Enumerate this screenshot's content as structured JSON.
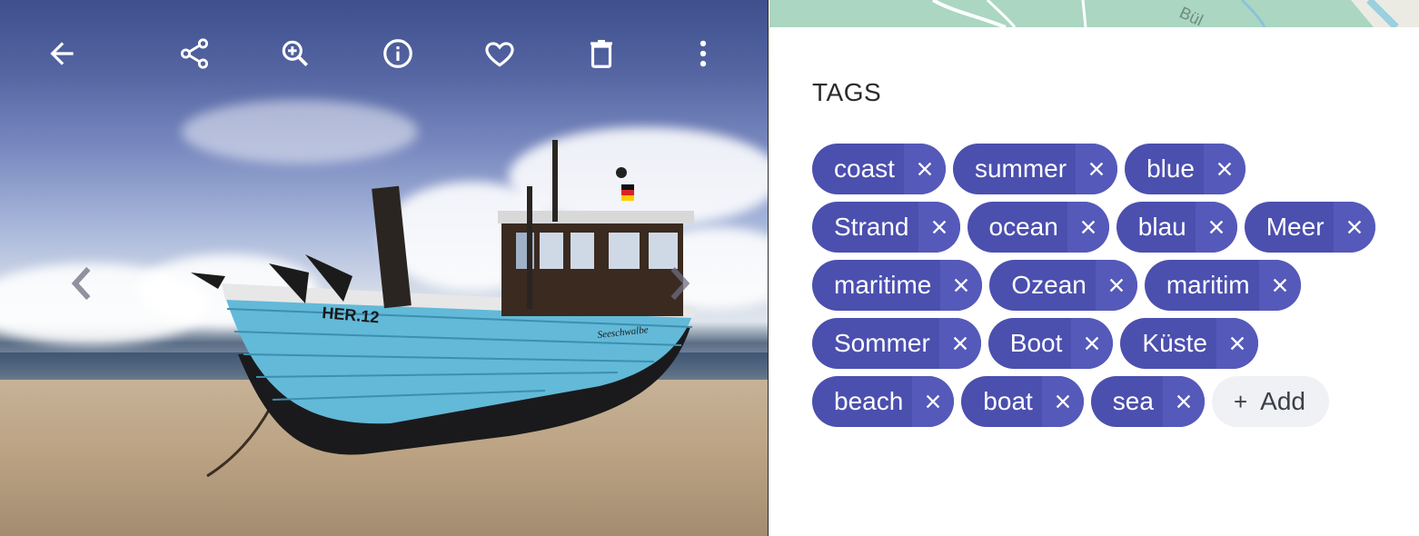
{
  "viewer": {
    "toolbar": [
      {
        "name": "back-button",
        "icon": "arrow-left-icon"
      },
      {
        "name": "share-button",
        "icon": "share-icon"
      },
      {
        "name": "zoom-in-button",
        "icon": "zoom-in-icon"
      },
      {
        "name": "info-button",
        "icon": "info-icon"
      },
      {
        "name": "favorite-button",
        "icon": "heart-icon"
      },
      {
        "name": "delete-button",
        "icon": "trash-icon"
      },
      {
        "name": "more-button",
        "icon": "more-vert-icon"
      }
    ],
    "photo": {
      "boat_registration": "HER.12",
      "boat_name": "Seeschwalbe"
    },
    "nav": {
      "previous_icon": "chevron-left-icon",
      "next_icon": "chevron-right-icon"
    }
  },
  "panel": {
    "tags_heading": "TAGS",
    "tags": [
      "coast",
      "summer",
      "blue",
      "Strand",
      "ocean",
      "blau",
      "Meer",
      "maritime",
      "Ozean",
      "maritim",
      "Sommer",
      "Boot",
      "Küste",
      "beach",
      "boat",
      "sea"
    ],
    "add_label": "Add",
    "remove_icon": "close-icon",
    "map_label": "Bül"
  },
  "colors": {
    "chip_bg": "#4b4fae",
    "chip_remove_bg": "#5559b9",
    "chip_text": "#ffffff",
    "add_chip_bg": "#f0f1f4",
    "map_green": "#aad6c2"
  }
}
